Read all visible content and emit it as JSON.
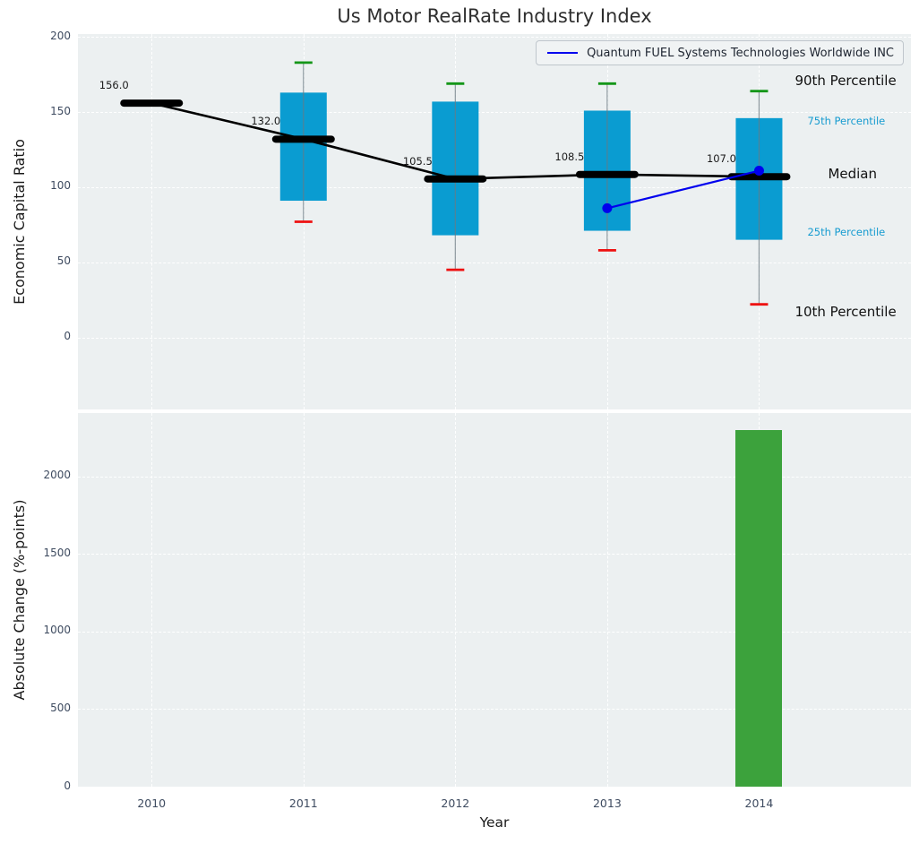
{
  "chart_data": [
    {
      "type": "box",
      "title": "Us Motor RealRate Industry Index",
      "ylabel": "Economic Capital Ratio",
      "xlabel": "",
      "x": [
        2010,
        2011,
        2012,
        2013,
        2014
      ],
      "xtick_labels": [
        "2010",
        "2011",
        "2012",
        "2013",
        "2014"
      ],
      "ytick_values": [
        0,
        50,
        100,
        150,
        200
      ],
      "ylim": [
        -48,
        202
      ],
      "xlim": [
        2009.515,
        2015.0
      ],
      "grid": true,
      "legend_position": "upper right",
      "medians": [
        156.0,
        132.0,
        105.5,
        108.5,
        107.0
      ],
      "median_labels": [
        "156.0",
        "132.0",
        "105.5",
        "108.5",
        "107.0"
      ],
      "p10": [
        null,
        77,
        45,
        58,
        22
      ],
      "p25": [
        null,
        91,
        68,
        71,
        65
      ],
      "p75": [
        null,
        163,
        157,
        151,
        146
      ],
      "p90": [
        null,
        183,
        169,
        169,
        164
      ],
      "series": [
        {
          "name": "Quantum FUEL Systems Technologies Worldwide INC",
          "x": [
            2013,
            2014
          ],
          "y": [
            86,
            111
          ],
          "color": "#0000ee"
        }
      ],
      "annotations": [
        {
          "text": "90th Percentile",
          "color": "#111111",
          "size": "large",
          "anchor": "p90"
        },
        {
          "text": "75th Percentile",
          "color": "#169bd0",
          "size": "small",
          "anchor": "p75"
        },
        {
          "text": "Median",
          "color": "#111111",
          "size": "large",
          "anchor": "median"
        },
        {
          "text": "25th Percentile",
          "color": "#169bd0",
          "size": "small",
          "anchor": "p25"
        },
        {
          "text": "10th Percentile",
          "color": "#111111",
          "size": "large",
          "anchor": "p10"
        }
      ],
      "colors": {
        "box": "#0a9cd1",
        "median": "#000000",
        "whisker": "#6b7a82",
        "cap_top": "#149618",
        "cap_bottom": "#ee1111",
        "background": "#ecf0f1",
        "grid": "#ffffff",
        "tick": "#3e4b60"
      }
    },
    {
      "type": "bar",
      "ylabel": "Absolute Change (%-points)",
      "xlabel": "Year",
      "categories": [
        "2010",
        "2011",
        "2012",
        "2013",
        "2014"
      ],
      "values": [
        null,
        null,
        null,
        null,
        2300
      ],
      "ytick_values": [
        0,
        500,
        1000,
        1500,
        2000
      ],
      "ylim": [
        0,
        2410
      ],
      "grid": true,
      "bar_color": "#3ca23c",
      "background": "#ecf0f1"
    }
  ]
}
